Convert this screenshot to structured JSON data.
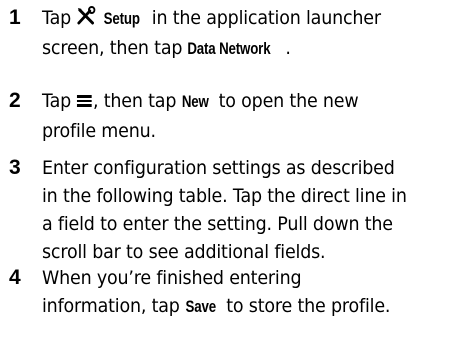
{
  "steps": [
    {
      "number": "1",
      "lines": [
        {
          "pre": "Tap ",
          "icon": "setup-tools-icon",
          "kw": "Setup",
          "post": " in the application launcher"
        },
        {
          "pre": "screen, then tap ",
          "kw": "Data Network",
          "post": "."
        }
      ]
    },
    {
      "number": "2",
      "lines": [
        {
          "pre": "Tap ",
          "icon": "menu-icon",
          "mid": ", then tap ",
          "kw": "New",
          "post": " to open the new"
        },
        {
          "pre": "profile menu."
        }
      ]
    },
    {
      "number": "3",
      "lines": [
        {
          "pre": "Enter configuration settings as described"
        },
        {
          "pre": "in the following table. Tap the direct line in"
        },
        {
          "pre": "a field to enter the setting. Pull down the"
        },
        {
          "pre": "scroll bar to see additional fields."
        }
      ]
    },
    {
      "number": "4",
      "lines": [
        {
          "pre": "When you’re finished entering"
        },
        {
          "pre": "information, tap ",
          "kw": "Save",
          "post": " to store the profile."
        }
      ]
    }
  ]
}
